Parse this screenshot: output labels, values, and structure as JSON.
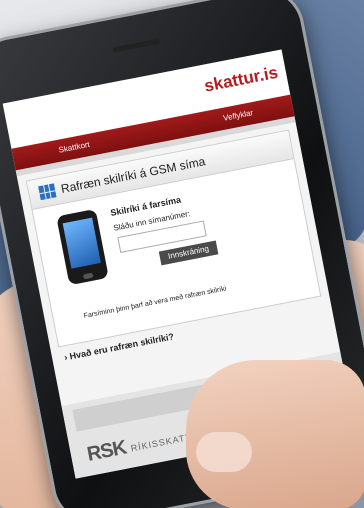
{
  "site": {
    "brand": "skattur.is"
  },
  "nav": {
    "item_left": "Skattkort",
    "item_right": "Veflyklar"
  },
  "panel": {
    "title": "Rafræn skilríki á GSM síma",
    "label_main": "Skilríki á farsíma",
    "label_input": "Sláðu inn símanúmer:",
    "login_button": "Innskráning",
    "note": "Farsíminn þinn þarf að vera með rafræn skilríki"
  },
  "faq": {
    "link": "Hvað eru rafræn skilríki?"
  },
  "footer": {
    "logo": "RSK",
    "org": "RÍKISSKATTSTJÓRI"
  }
}
